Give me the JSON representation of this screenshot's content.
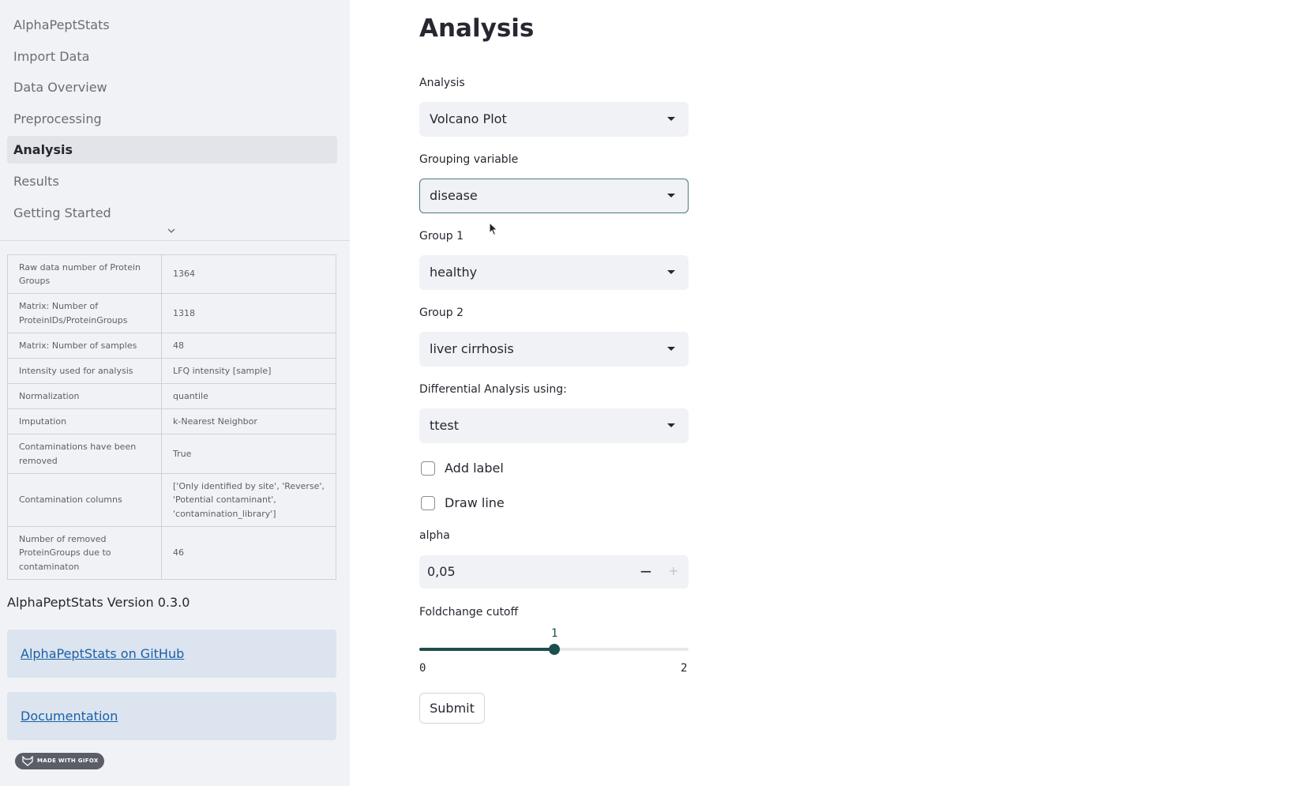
{
  "sidebar": {
    "nav": [
      "AlphaPeptStats",
      "Import Data",
      "Data Overview",
      "Preprocessing",
      "Analysis",
      "Results",
      "Getting Started"
    ],
    "active": "Analysis",
    "table": [
      {
        "key": "Raw data number of Protein Groups",
        "value": "1364"
      },
      {
        "key": "Matrix: Number of ProteinIDs/ProteinGroups",
        "value": "1318"
      },
      {
        "key": "Matrix: Number of samples",
        "value": "48"
      },
      {
        "key": "Intensity used for analysis",
        "value": "LFQ intensity [sample]"
      },
      {
        "key": "Normalization",
        "value": "quantile"
      },
      {
        "key": "Imputation",
        "value": "k-Nearest Neighbor"
      },
      {
        "key": "Contaminations have been removed",
        "value": "True"
      },
      {
        "key": "Contamination columns",
        "value": "['Only identified by site', 'Reverse', 'Potential contaminant', 'contamination_library']"
      },
      {
        "key": "Number of removed ProteinGroups due to contaminaton",
        "value": "46"
      }
    ],
    "version": "AlphaPeptStats Version 0.3.0",
    "links": [
      "AlphaPeptStats on GitHub",
      "Documentation"
    ],
    "badge": "MADE WITH GIFOX"
  },
  "main": {
    "title": "Analysis",
    "analysis": {
      "label": "Analysis",
      "value": "Volcano Plot"
    },
    "grouping": {
      "label": "Grouping variable",
      "value": "disease"
    },
    "group1": {
      "label": "Group 1",
      "value": "healthy"
    },
    "group2": {
      "label": "Group 2",
      "value": "liver cirrhosis"
    },
    "method": {
      "label": "Differential Analysis using:",
      "value": "ttest"
    },
    "add_label": {
      "label": "Add label",
      "checked": false
    },
    "draw_line": {
      "label": "Draw line",
      "checked": false
    },
    "alpha": {
      "label": "alpha",
      "value": "0,05",
      "minus": "−",
      "plus": "+"
    },
    "foldchange": {
      "label": "Foldchange cutoff",
      "value": "1",
      "min": "0",
      "max": "2",
      "fraction": 0.5
    },
    "submit": "Submit"
  },
  "colors": {
    "accent": "#1d4e4e",
    "sidebar_bg": "#f0f2f6",
    "link": "#1b5fa6"
  }
}
